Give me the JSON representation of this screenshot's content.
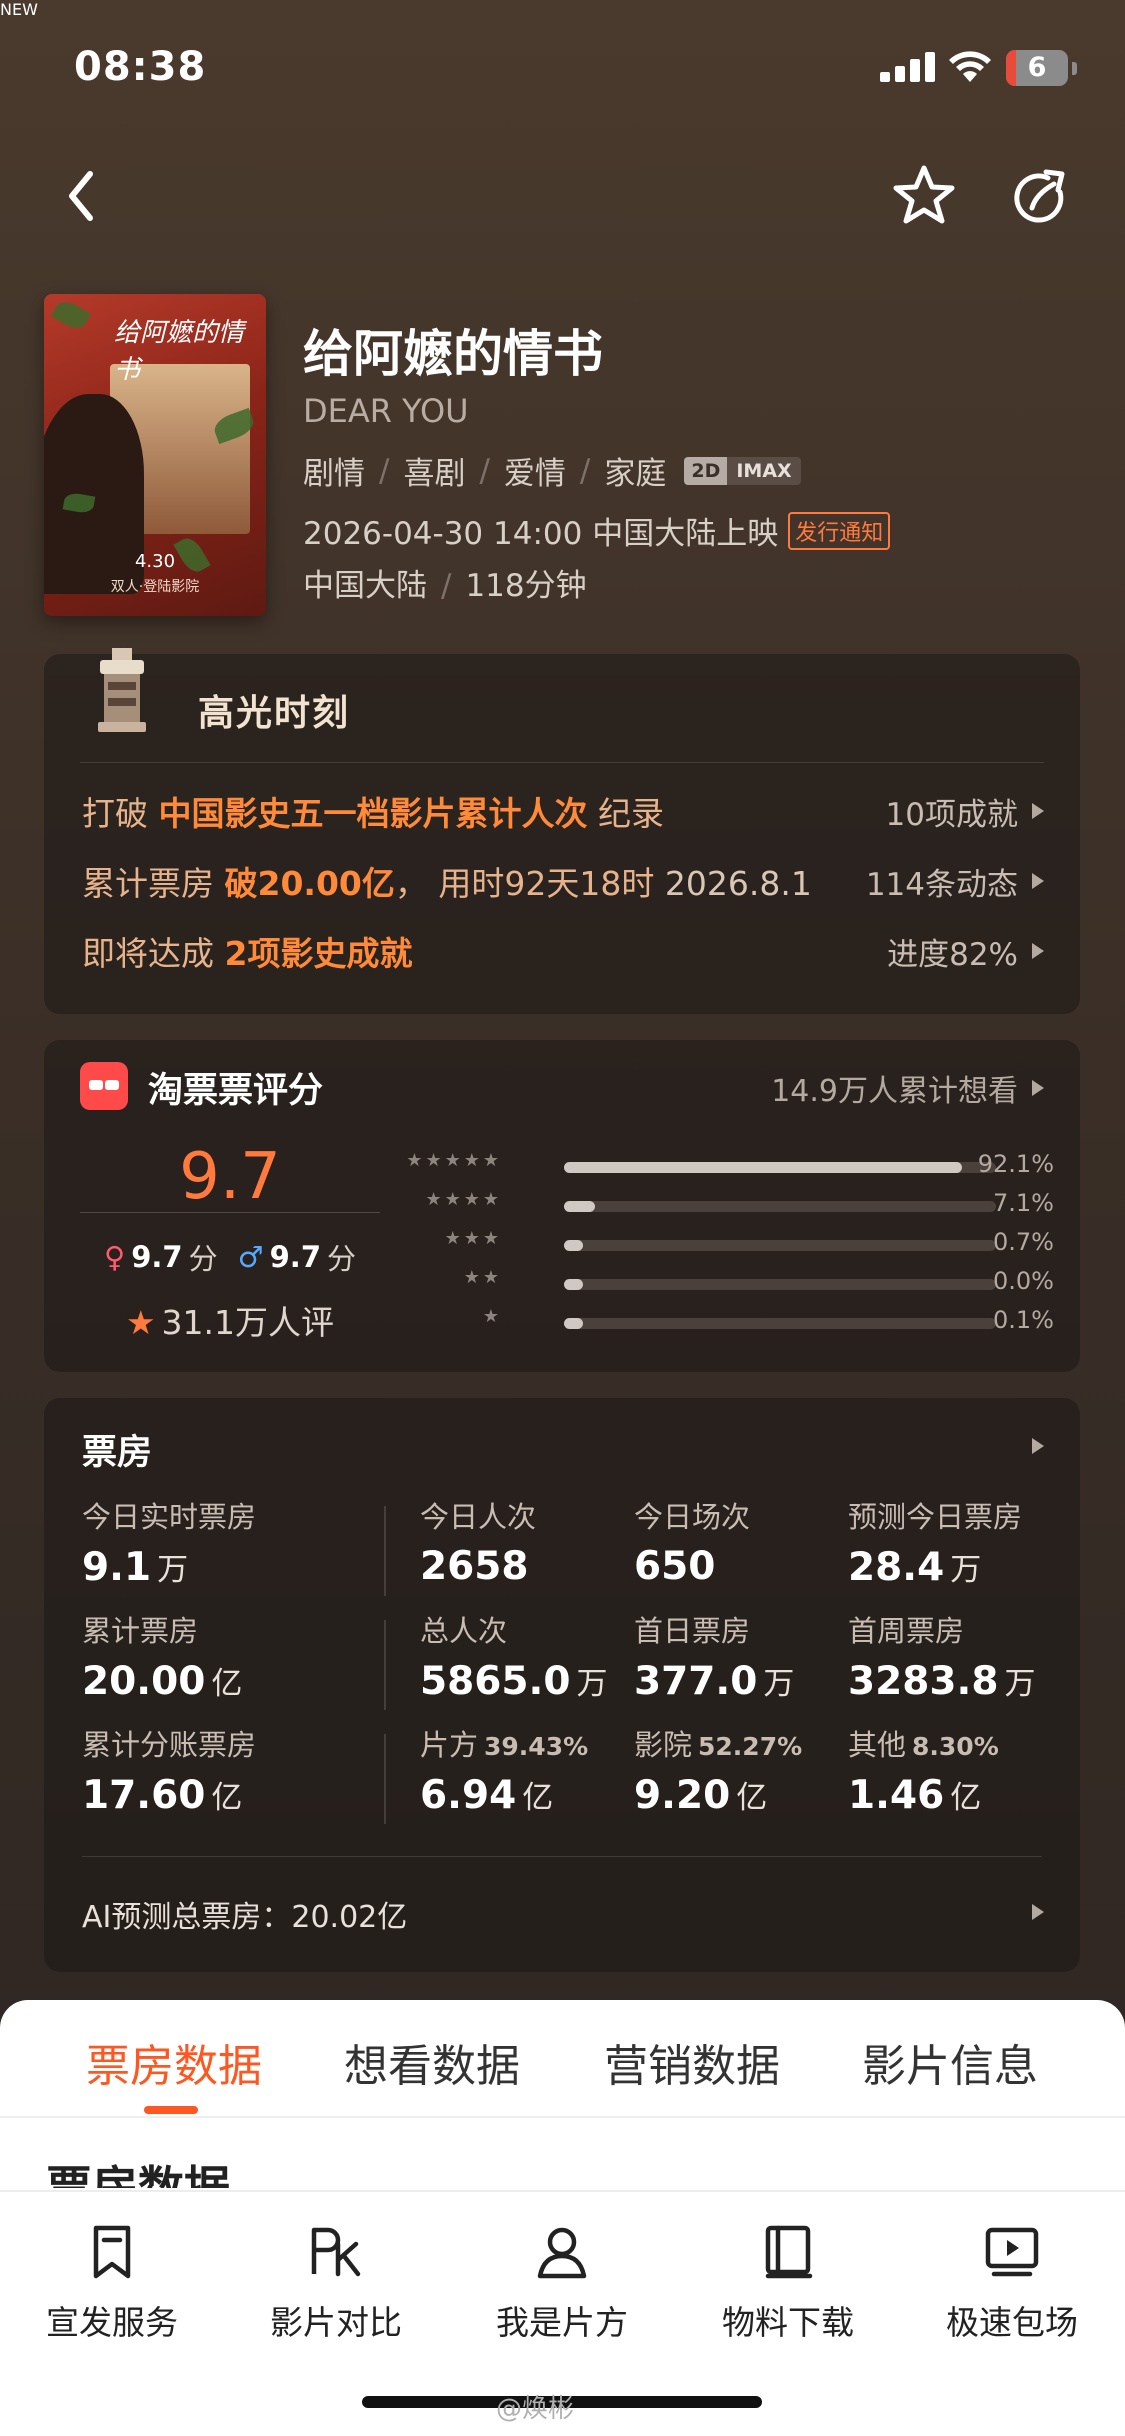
{
  "status_bar": {
    "time": "08:38",
    "battery": "6"
  },
  "movie": {
    "title": "给阿嬷的情书",
    "english_title": "DEAR YOU",
    "genres": [
      "剧情",
      "喜剧",
      "爱情",
      "家庭"
    ],
    "formats": [
      "2D",
      "IMAX"
    ],
    "release": "2026-04-30 14:00 中国大陆上映",
    "release_badge": "发行通知",
    "region": "中国大陆",
    "duration": "118分钟",
    "poster": {
      "title": "给阿嬷的情书",
      "date": "4.30",
      "sub": "双人·登陆影院"
    }
  },
  "highlights": {
    "title": "高光时刻",
    "rows": [
      {
        "pre": "打破 ",
        "hi": "中国影史五一档影片累计人次",
        "post": " 纪录",
        "right": "10项成就"
      },
      {
        "pre": "累计票房 ",
        "hi": "破20.00亿",
        "post": "，  用时92天18时 ",
        "dim": "2026.8.1",
        "right": "114条动态"
      },
      {
        "pre": "即将达成 ",
        "hi": "2项影史成就",
        "post": "",
        "right": "进度82%"
      }
    ]
  },
  "rating": {
    "brand": "淘票票评分",
    "want": "14.9万人累计想看",
    "score": "9.7",
    "female_score": "9.7",
    "male_score": "9.7",
    "score_unit": "分",
    "count": "31.1万人评",
    "distribution": [
      {
        "stars": "★★★★★",
        "pct_label": "92.1%",
        "pct": 92.1
      },
      {
        "stars": "★★★★",
        "pct_label": "7.1%",
        "pct": 7.1
      },
      {
        "stars": "★★★",
        "pct_label": "0.7%",
        "pct": 0.7
      },
      {
        "stars": "★★",
        "pct_label": "0.0%",
        "pct": 0.0
      },
      {
        "stars": "★",
        "pct_label": "0.1%",
        "pct": 0.1
      }
    ]
  },
  "box_office": {
    "title": "票房",
    "cells": [
      {
        "label": "今日实时票房",
        "value": "9.1",
        "unit": "万"
      },
      {
        "label": "今日人次",
        "value": "2658",
        "unit": ""
      },
      {
        "label": "今日场次",
        "value": "650",
        "unit": ""
      },
      {
        "label": "预测今日票房",
        "value": "28.4",
        "unit": "万"
      },
      {
        "label": "累计票房",
        "value": "20.00",
        "unit": "亿"
      },
      {
        "label": "总人次",
        "value": "5865.0",
        "unit": "万"
      },
      {
        "label": "首日票房",
        "value": "377.0",
        "unit": "万"
      },
      {
        "label": "首周票房",
        "value": "3283.8",
        "unit": "万"
      },
      {
        "label": "累计分账票房",
        "value": "17.60",
        "unit": "亿"
      },
      {
        "label": "片方",
        "pct": "39.43%",
        "value": "6.94",
        "unit": "亿"
      },
      {
        "label": "影院",
        "pct": "52.27%",
        "value": "9.20",
        "unit": "亿"
      },
      {
        "label": "其他",
        "pct": "8.30%",
        "value": "1.46",
        "unit": "亿"
      }
    ],
    "ai_prediction": "AI预测总票房：20.02亿"
  },
  "tabs": [
    "票房数据",
    "想看数据",
    "营销数据",
    "影片信息"
  ],
  "section_title": "票房数据",
  "dock": [
    {
      "label": "宣发服务",
      "icon": "bookmark-icon"
    },
    {
      "label": "影片对比",
      "icon": "pk-icon"
    },
    {
      "label": "我是片方",
      "icon": "person-icon"
    },
    {
      "label": "物料下载",
      "icon": "book-icon"
    },
    {
      "label": "极速包场",
      "icon": "screen-play-icon"
    }
  ],
  "dock_badge": "NEW",
  "watermark": "@焕彬",
  "colors": {
    "accent": "#ff7a3c",
    "tab_active": "#ff5722",
    "highlight": "#ff8a3a"
  }
}
